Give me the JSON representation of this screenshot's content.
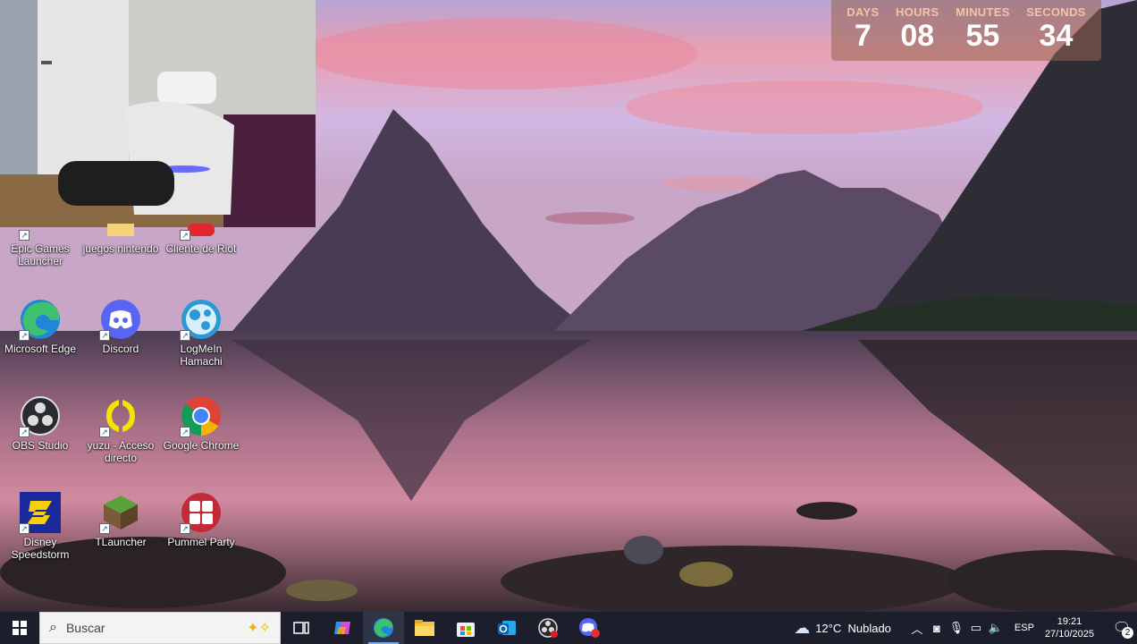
{
  "countdown": {
    "units": [
      {
        "label": "DAYS",
        "value": "7"
      },
      {
        "label": "HOURS",
        "value": "08"
      },
      {
        "label": "MINUTES",
        "value": "55"
      },
      {
        "label": "SECONDS",
        "value": "34"
      }
    ]
  },
  "desktop": {
    "icons": [
      {
        "label": "Epic Games\nLauncher",
        "icon": "epic-games-icon"
      },
      {
        "label": "juegos nintendo",
        "icon": "folder-icon"
      },
      {
        "label": "Cliente de Riot",
        "icon": "riot-client-icon"
      },
      {
        "label": "Microsoft Edge",
        "icon": "edge-icon"
      },
      {
        "label": "Discord",
        "icon": "discord-icon"
      },
      {
        "label": "LogMeIn\nHamachi",
        "icon": "hamachi-icon"
      },
      {
        "label": "OBS Studio",
        "icon": "obs-icon"
      },
      {
        "label": "yuzu - Acceso\ndirecto",
        "icon": "yuzu-icon"
      },
      {
        "label": "Google Chrome",
        "icon": "chrome-icon"
      },
      {
        "label": "Disney\nSpeedstorm",
        "icon": "disney-speedstorm-icon"
      },
      {
        "label": "TLauncher",
        "icon": "tlauncher-icon"
      },
      {
        "label": "Pummel Party",
        "icon": "pummel-party-icon"
      }
    ]
  },
  "taskbar": {
    "search_placeholder": "Buscar",
    "apps": [
      "task-view-icon",
      "copilot-icon",
      "edge-icon",
      "file-explorer-icon",
      "microsoft-store-icon",
      "outlook-icon",
      "obs-icon",
      "discord-icon"
    ],
    "weather": {
      "temp": "12°C",
      "condition": "Nublado"
    },
    "language": "ESP",
    "time": "19:21",
    "date": "27/10/2025",
    "notifications": "2"
  },
  "colors": {
    "taskbar_bg": "#1c1f2b",
    "countdown_label": "#f0c6a0"
  }
}
